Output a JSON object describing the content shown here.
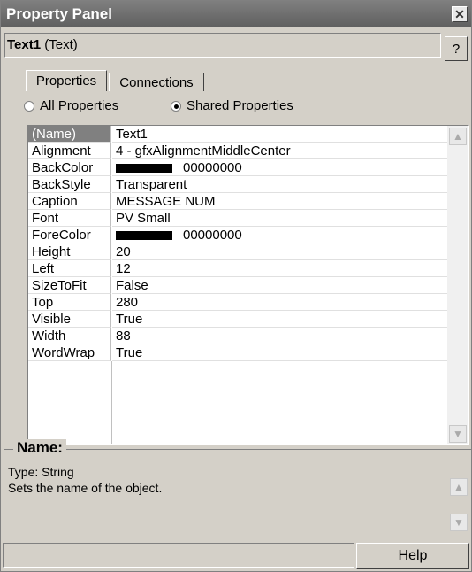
{
  "window": {
    "title": "Property Panel",
    "close_glyph": "✕"
  },
  "object": {
    "name": "Text1",
    "type": "(Text)",
    "help_label": "?"
  },
  "tabs": [
    {
      "label": "Properties"
    },
    {
      "label": "Connections"
    }
  ],
  "radios": [
    {
      "label": "All Properties",
      "selected": false
    },
    {
      "label": "Shared Properties",
      "selected": true
    }
  ],
  "properties": [
    {
      "name": "(Name)",
      "value": "Text1"
    },
    {
      "name": "Alignment",
      "value": "4 - gfxAlignmentMiddleCenter"
    },
    {
      "name": "BackColor",
      "value": "00000000"
    },
    {
      "name": "BackStyle",
      "value": "Transparent"
    },
    {
      "name": "Caption",
      "value": "MESSAGE NUM"
    },
    {
      "name": "Font",
      "value": "PV Small"
    },
    {
      "name": "ForeColor",
      "value": "00000000"
    },
    {
      "name": "Height",
      "value": "20"
    },
    {
      "name": "Left",
      "value": "12"
    },
    {
      "name": "SizeToFit",
      "value": "False"
    },
    {
      "name": "Top",
      "value": "280"
    },
    {
      "name": "Visible",
      "value": "True"
    },
    {
      "name": "Width",
      "value": "88"
    },
    {
      "name": "WordWrap",
      "value": "True"
    }
  ],
  "description": {
    "heading": "Name:",
    "type_line": "Type: String",
    "text": "Sets the name of the object."
  },
  "footer": {
    "help_label": "Help"
  },
  "colors": {
    "swatch": "#000000",
    "titlebar": "#6a6a6a",
    "selected_row": "#808080"
  }
}
